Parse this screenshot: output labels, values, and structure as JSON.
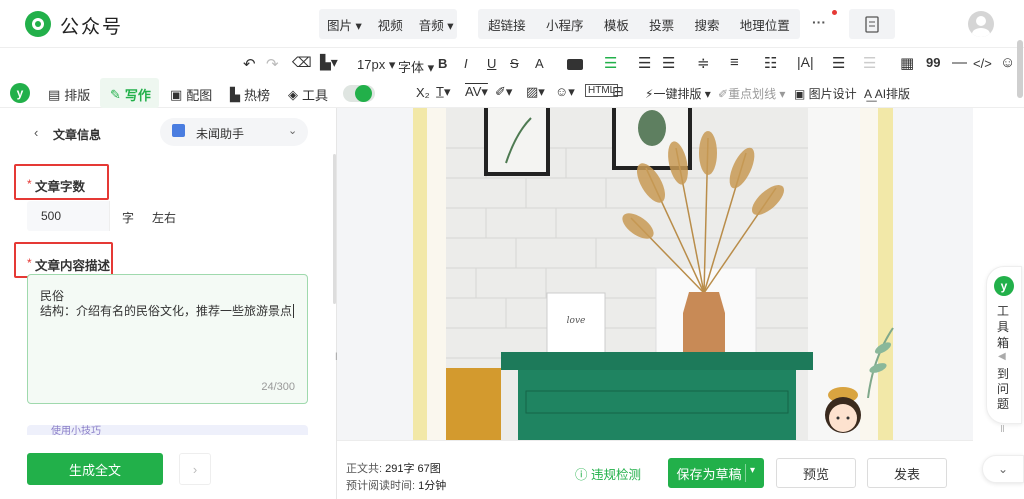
{
  "header": {
    "app_name": "公众号",
    "menu_group1": [
      "图片",
      "视频",
      "音频"
    ],
    "menu_group2": [
      "超链接",
      "小程序",
      "模板",
      "投票",
      "搜索",
      "地理位置"
    ],
    "more_label": "···"
  },
  "toolbar": {
    "font_size": "17px",
    "font_family": "字体",
    "bold": "B",
    "italic": "I",
    "underline": "U",
    "strike": "S",
    "font_color": "A",
    "subscript": "X₂",
    "quote": "99",
    "code": "</>",
    "one_click_layout": "一键排版",
    "key_line": "重点划线",
    "image_design": "图片设计",
    "ai_layout": "AI排版"
  },
  "tabs": [
    "排版",
    "写作",
    "配图",
    "热榜",
    "工具"
  ],
  "panel": {
    "back_title": "文章信息",
    "assistant": "未闻助手",
    "word_count_label": "文章字数",
    "word_count_value": "500",
    "word_unit": "字",
    "approx": "左右",
    "desc_label": "文章内容描述",
    "desc_line1": "民俗",
    "desc_line2": "结构：介绍有名的民俗文化，推荐一些旅游景点",
    "desc_counter": "24/300",
    "tips_text": "使用小技巧",
    "generate_button": "生成全文",
    "required_mark": "*"
  },
  "side_tool": {
    "toolbox": "工具箱",
    "find_issue": "到问题"
  },
  "footer": {
    "stats_prefix": "正文共:",
    "char_count": "291字",
    "img_count": "67图",
    "read_label": "预计阅读时间:",
    "read_time": "1分钟",
    "violation_check": "违规检测",
    "save_draft": "保存为草稿",
    "preview": "预览",
    "publish": "发表"
  },
  "colors": {
    "brand": "#22b04a",
    "highlight": "#e53935"
  }
}
